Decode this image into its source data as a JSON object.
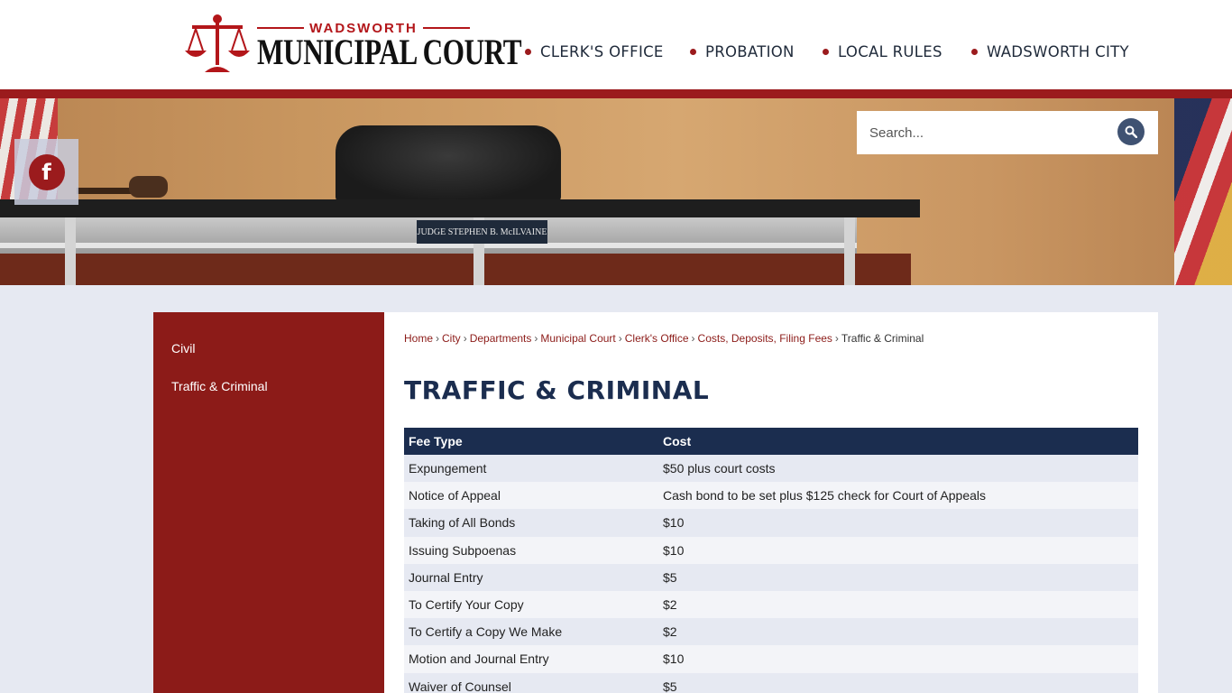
{
  "logo": {
    "small_title": "WADSWORTH",
    "big_title": "MUNICIPAL COURT"
  },
  "nav": [
    "CLERK'S OFFICE",
    "PROBATION",
    "LOCAL RULES",
    "WADSWORTH CITY"
  ],
  "banner": {
    "nameplate": "JUDGE STEPHEN B. McILVAINE"
  },
  "search": {
    "placeholder": "Search..."
  },
  "social": {
    "facebook_glyph": "f"
  },
  "sidebar": {
    "items": [
      "Civil",
      "Traffic & Criminal"
    ]
  },
  "breadcrumb": [
    "Home",
    "City",
    "Departments",
    "Municipal Court",
    "Clerk's Office",
    "Costs, Deposits, Filing Fees",
    "Traffic & Criminal"
  ],
  "page_title": "TRAFFIC & CRIMINAL",
  "table": {
    "headers": [
      "Fee Type",
      "Cost"
    ],
    "rows": [
      [
        "Expungement",
        "$50 plus court costs"
      ],
      [
        "Notice of Appeal",
        "Cash bond to be set plus $125 check for Court of Appeals"
      ],
      [
        "Taking of All Bonds",
        "$10"
      ],
      [
        "Issuing Subpoenas",
        "$10"
      ],
      [
        "Journal Entry",
        "$5"
      ],
      [
        "To Certify Your Copy",
        "$2"
      ],
      [
        "To Certify a Copy We Make",
        "$2"
      ],
      [
        "Motion and Journal Entry",
        "$10"
      ],
      [
        "Waiver of Counsel",
        "$5"
      ]
    ]
  },
  "colors": {
    "brand_red": "#9b1b1d",
    "navy": "#1b2d4f",
    "sidebar_red": "#8c1b18"
  }
}
